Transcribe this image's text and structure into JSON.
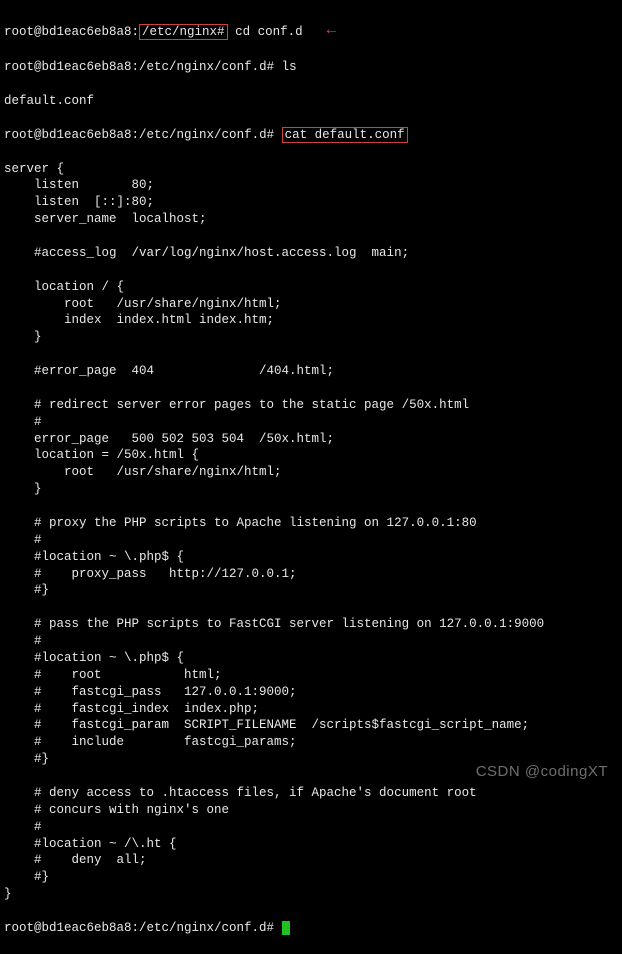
{
  "prompt": {
    "user_host": "root@bd1eac6eb8a8",
    "path_highlight": "/etc/nginx#",
    "cmd_cd": "cd conf.d",
    "path_confd": "/etc/nginx/conf.d#",
    "cmd_ls": "ls",
    "ls_output": "default.conf",
    "cmd_cat_highlight": "cat default.conf"
  },
  "config": {
    "lines": [
      "server {",
      "    listen       80;",
      "    listen  [::]:80;",
      "    server_name  localhost;",
      "",
      "    #access_log  /var/log/nginx/host.access.log  main;",
      "",
      "    location / {",
      "        root   /usr/share/nginx/html;",
      "        index  index.html index.htm;",
      "    }",
      "",
      "    #error_page  404              /404.html;",
      "",
      "    # redirect server error pages to the static page /50x.html",
      "    #",
      "    error_page   500 502 503 504  /50x.html;",
      "    location = /50x.html {",
      "        root   /usr/share/nginx/html;",
      "    }",
      "",
      "    # proxy the PHP scripts to Apache listening on 127.0.0.1:80",
      "    #",
      "    #location ~ \\.php$ {",
      "    #    proxy_pass   http://127.0.0.1;",
      "    #}",
      "",
      "    # pass the PHP scripts to FastCGI server listening on 127.0.0.1:9000",
      "    #",
      "    #location ~ \\.php$ {",
      "    #    root           html;",
      "    #    fastcgi_pass   127.0.0.1:9000;",
      "    #    fastcgi_index  index.php;",
      "    #    fastcgi_param  SCRIPT_FILENAME  /scripts$fastcgi_script_name;",
      "    #    include        fastcgi_params;",
      "    #}",
      "",
      "    # deny access to .htaccess files, if Apache's document root",
      "    # concurs with nginx's one",
      "    #",
      "    #location ~ /\\.ht {",
      "    #    deny  all;",
      "    #}",
      "}",
      ""
    ]
  },
  "watermark": "CSDN @codingXT",
  "bottom_prompt": {
    "text": "root@bd1eac6eb8a8:/etc/nginx/conf.d# "
  }
}
